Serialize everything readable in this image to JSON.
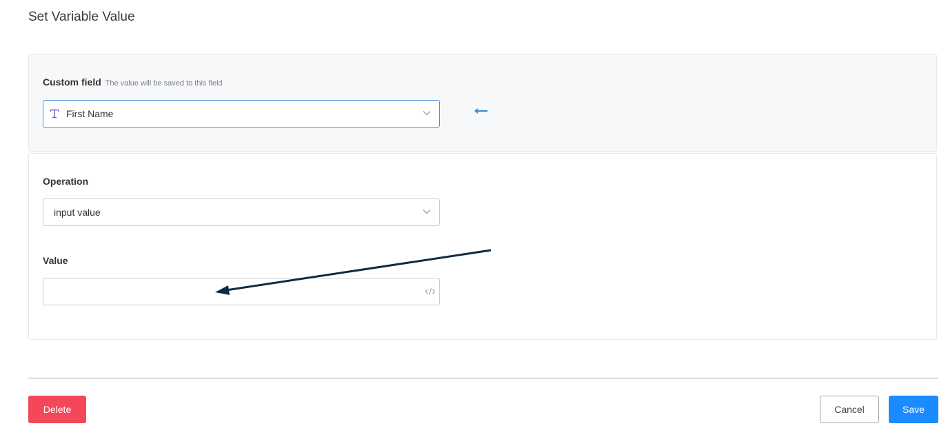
{
  "title": "Set Variable Value",
  "custom_field": {
    "label": "Custom field",
    "hint": "The value will be saved to this field",
    "selected": "First Name",
    "type_icon": "text-type-icon"
  },
  "operation": {
    "label": "Operation",
    "selected": "input value"
  },
  "value": {
    "label": "Value",
    "current_value": "",
    "icon": "code-icon"
  },
  "buttons": {
    "delete": "Delete",
    "cancel": "Cancel",
    "save": "Save"
  },
  "colors": {
    "delete": "#f5475a",
    "save": "#1a8cff",
    "focus_border": "#4a90d9",
    "annotation_arrow": "#0f2a44",
    "pointer_arrow": "#3b8fd6",
    "type_icon": "#8a4fd1"
  }
}
